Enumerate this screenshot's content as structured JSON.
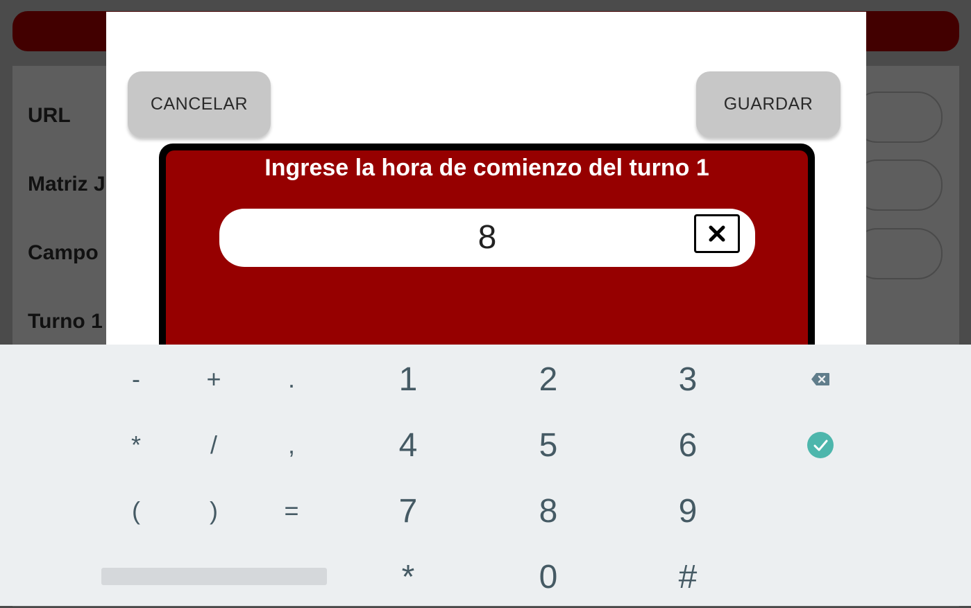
{
  "background": {
    "labels": [
      "URL",
      "Matriz J",
      "Campo",
      "Turno 1"
    ]
  },
  "dialog": {
    "cancel_label": "CANCELAR",
    "save_label": "GUARDAR"
  },
  "prompt": {
    "title": "Ingrese la hora de comienzo del turno 1",
    "value": "8",
    "clear_icon": "clear-x-icon"
  },
  "keyboard": {
    "rows": [
      [
        "-",
        "+",
        ".",
        "1",
        "2",
        "3"
      ],
      [
        "*",
        "/",
        ",",
        "4",
        "5",
        "6"
      ],
      [
        "(",
        ")",
        "=",
        "7",
        "8",
        "9"
      ],
      [
        "*",
        "0",
        "#"
      ]
    ],
    "backspace_icon": "backspace-icon",
    "done_icon": "check-circle-icon",
    "accent_color": "#4db6ac"
  }
}
